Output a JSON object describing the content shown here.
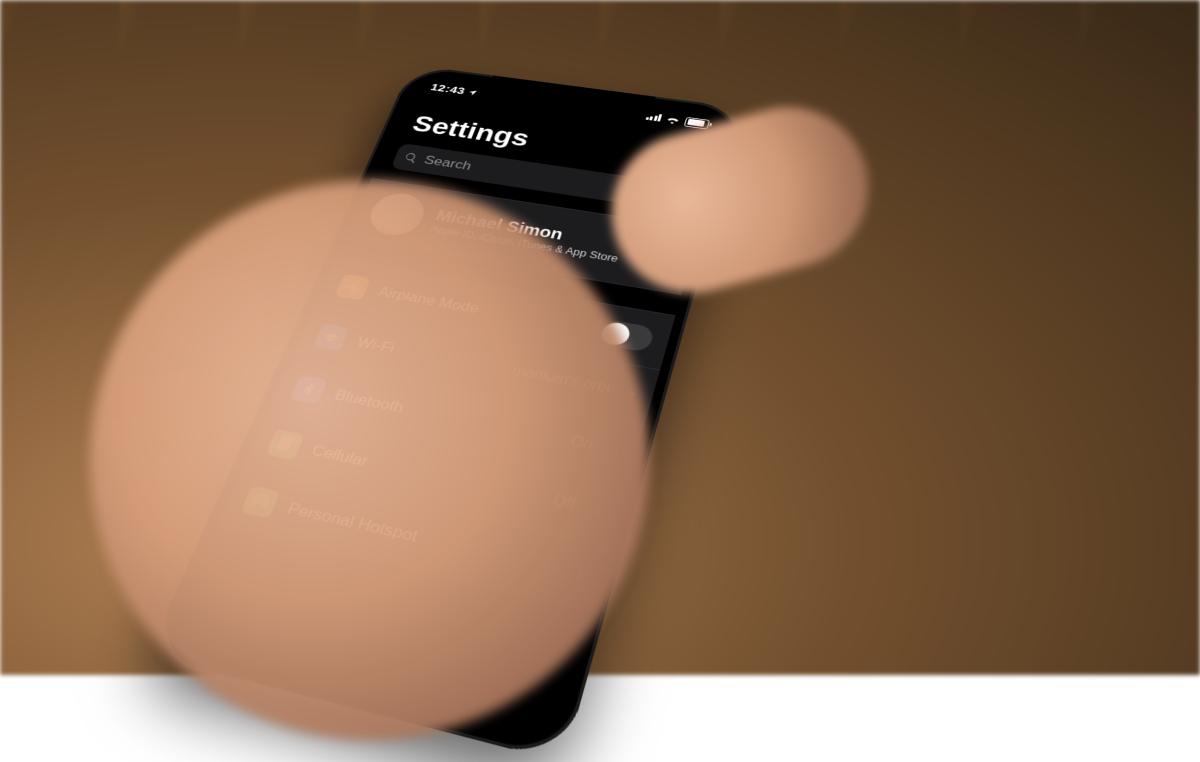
{
  "status": {
    "time": "12:43"
  },
  "title": "Settings",
  "search": {
    "placeholder": "Search"
  },
  "profile": {
    "name": "Michael Simon",
    "subtitle": "Apple ID, iCloud, iTunes & App Store"
  },
  "rows": [
    {
      "icon": "airplane",
      "icon_name": "airplane-icon",
      "color": "c-orange",
      "label": "Airplane Mode",
      "type": "toggle",
      "toggle_on": false
    },
    {
      "icon": "wifi",
      "icon_name": "wifi-icon",
      "color": "c-blue",
      "label": "Wi-Fi",
      "type": "link",
      "value": "morlium's orbi"
    },
    {
      "icon": "bluetooth",
      "icon_name": "bluetooth-icon",
      "color": "c-blue2",
      "label": "Bluetooth",
      "type": "link",
      "value": "On"
    },
    {
      "icon": "cellular",
      "icon_name": "cellular-icon",
      "color": "c-green",
      "label": "Cellular",
      "type": "link",
      "value": "Off"
    },
    {
      "icon": "hotspot",
      "icon_name": "hotspot-icon",
      "color": "c-green2",
      "label": "Personal Hotspot",
      "type": "link",
      "value": ""
    }
  ]
}
